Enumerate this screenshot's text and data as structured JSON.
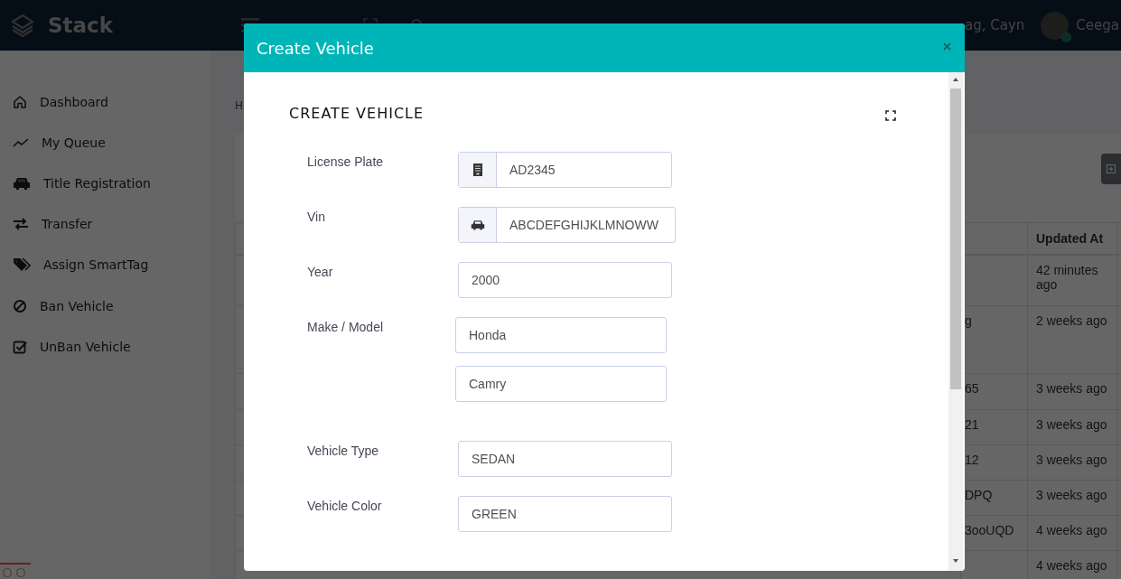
{
  "topbar": {
    "brand": "Stack",
    "user_name": "ag, Cayn",
    "profile_name": "Ceega"
  },
  "sidebar": {
    "items": [
      {
        "label": "Dashboard"
      },
      {
        "label": "My Queue"
      },
      {
        "label": "Title Registration"
      },
      {
        "label": "Transfer"
      },
      {
        "label": "Assign SmartTag"
      },
      {
        "label": "Ban Vehicle"
      },
      {
        "label": "UnBan Vehicle"
      }
    ]
  },
  "page": {
    "breadcrumb": "H"
  },
  "table": {
    "header": "Updated At",
    "rows": [
      {
        "updated_at": "42 minutes ago"
      },
      {
        "column_1": "g",
        "updated_at": "2 weeks ago"
      },
      {
        "column_1": "65",
        "updated_at": "3 weeks ago"
      },
      {
        "column_1": "21",
        "updated_at": "3 weeks ago"
      },
      {
        "column_1": "12",
        "updated_at": "3 weeks ago"
      },
      {
        "column_1": "DPQ",
        "updated_at": "3 weeks ago"
      },
      {
        "column_1": "3ooUQD",
        "updated_at": "4 weeks ago"
      },
      {
        "updated_at": "4 weeks ago"
      }
    ]
  },
  "modal": {
    "title": "Create Vehicle",
    "heading": "CREATE VEHICLE",
    "fields": [
      {
        "kind": "addon",
        "label": "License Plate",
        "values": [
          "AD2345"
        ]
      },
      {
        "kind": "addon",
        "label": "Vin",
        "values": [
          "ABCDEFGHIJKLMNOWW"
        ]
      },
      {
        "kind": "plain",
        "label": "Year",
        "values": [
          "2000"
        ]
      },
      {
        "kind": "pair",
        "label": "Make / Model",
        "values": [
          "Honda",
          "Camry"
        ]
      },
      {
        "kind": "plain",
        "label": "Vehicle Type",
        "values": [
          "SEDAN"
        ]
      },
      {
        "kind": "plain",
        "label": "Vehicle Color",
        "values": [
          "GREEN"
        ]
      }
    ]
  }
}
